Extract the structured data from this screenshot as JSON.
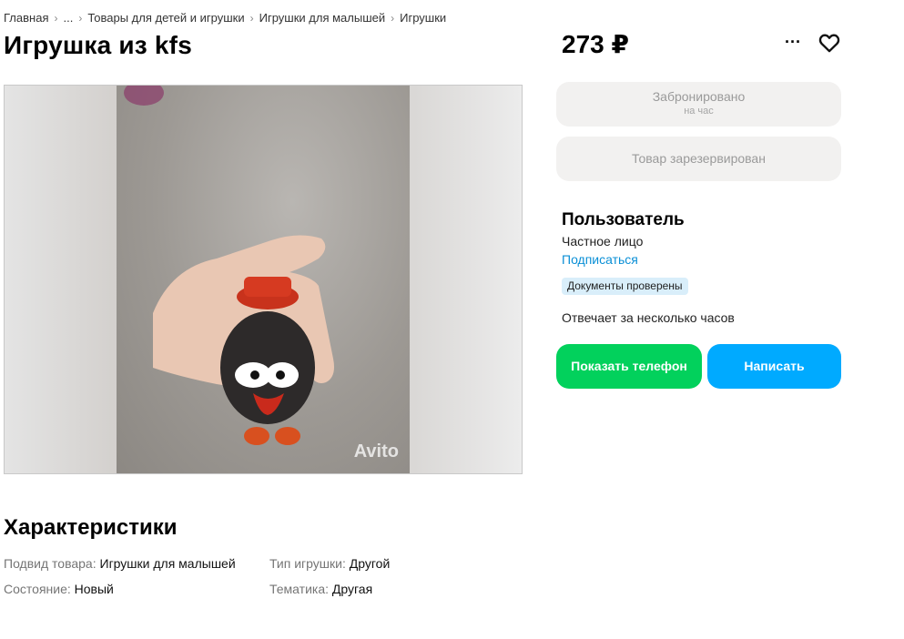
{
  "breadcrumb": {
    "items": [
      "Главная",
      "...",
      "Товары для детей и игрушки",
      "Игрушки для малышей",
      "Игрушки"
    ]
  },
  "listing": {
    "title": "Игрушка из kfs",
    "price": "273 ₽",
    "watermark": "Avito"
  },
  "actions": {
    "more_icon": "more-dots-icon",
    "more_label": "···",
    "favorite_icon": "heart-icon",
    "reserve_label": "Забронировано",
    "reserve_sub": "на час",
    "reserved_label": "Товар зарезервирован",
    "phone_label": "Показать телефон",
    "write_label": "Написать"
  },
  "seller": {
    "name": "Пользователь",
    "type": "Частное лицо",
    "subscribe": "Подписаться",
    "docs_badge": "Документы проверены",
    "response_time": "Отвечает за несколько часов"
  },
  "specs": {
    "title": "Характеристики",
    "items": [
      {
        "key": "Подвид товара:",
        "value": "Игрушки для малышей"
      },
      {
        "key": "Тип игрушки:",
        "value": "Другой"
      },
      {
        "key": "Состояние:",
        "value": "Новый"
      },
      {
        "key": "Тематика:",
        "value": "Другая"
      }
    ]
  },
  "colors": {
    "green": "#02d15c",
    "blue": "#00aaff",
    "link": "#0a8fd6",
    "badge": "#d9eefa"
  }
}
